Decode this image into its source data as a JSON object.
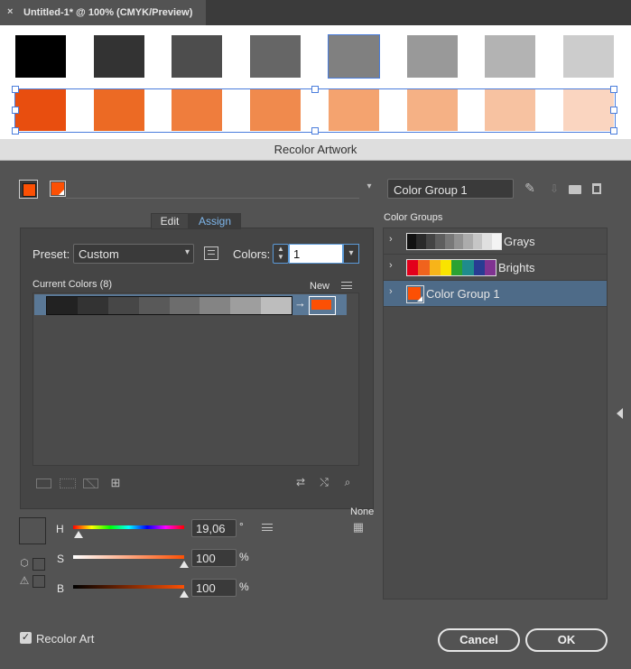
{
  "document": {
    "tab_close": "×",
    "tab_title": "Untitled-1* @ 100% (CMYK/Preview)",
    "gray_swatches": [
      "#000000",
      "#333333",
      "#4d4d4d",
      "#666666",
      "#808080",
      "#999999",
      "#b3b3b3",
      "#cccccc"
    ],
    "orange_swatches": [
      "#e84e0f",
      "#ec6a24",
      "#ef7d3d",
      "#f08a4d",
      "#f4a36f",
      "#f5b185",
      "#f7c2a1",
      "#fad5c0"
    ]
  },
  "dialog": {
    "title": "Recolor Artwork",
    "color_group_name": "Color Group 1",
    "tabs": {
      "edit": "Edit",
      "assign": "Assign"
    },
    "preset_label": "Preset:",
    "preset_value": "Custom",
    "colors_label": "Colors:",
    "colors_value": "1",
    "current_colors_label": "Current Colors (8)",
    "new_label": "New",
    "current_color_bars": [
      "#222222",
      "#333333",
      "#474747",
      "#595959",
      "#6d6d6d",
      "#848484",
      "#9e9e9e",
      "#bdbdbd"
    ],
    "arrow": "→",
    "h_label": "H",
    "h_value": "19,06",
    "h_unit": "°",
    "s_label": "S",
    "s_value": "100",
    "s_unit": "%",
    "b_label": "B",
    "b_value": "100",
    "b_unit": "%",
    "none_label": "None",
    "recolor_art_label": "Recolor Art",
    "recolor_art_checked": true,
    "cancel_label": "Cancel",
    "ok_label": "OK",
    "color_groups_label": "Color Groups",
    "accent_color": "#fc5004",
    "color_groups": [
      {
        "name": "Grays",
        "colors": [
          "#111111",
          "#2a2a2a",
          "#444444",
          "#5e5e5e",
          "#787878",
          "#929292",
          "#acacac",
          "#c6c6c6",
          "#e0e0e0",
          "#f4f4f4"
        ]
      },
      {
        "name": "Brights",
        "colors": [
          "#e3001b",
          "#f0631d",
          "#f7b419",
          "#f9e400",
          "#2ba232",
          "#1f8b8d",
          "#283c92",
          "#803391"
        ]
      },
      {
        "name": "Color Group 1",
        "colors": [
          "#fc5004"
        ]
      }
    ]
  }
}
